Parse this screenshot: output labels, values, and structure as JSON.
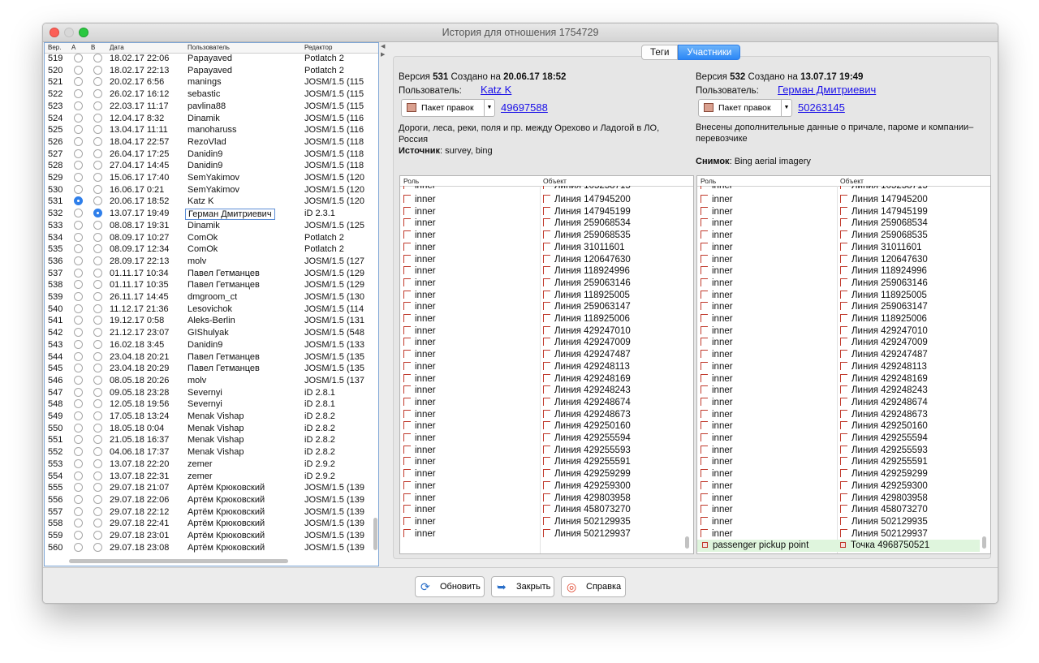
{
  "window": {
    "title": "История для отношения 1754729"
  },
  "left": {
    "headers": [
      "Вер.",
      "A",
      "B",
      "Дата",
      "Пользователь",
      "Редактор"
    ],
    "rows": [
      {
        "ver": "519",
        "date": "18.02.17 22:06",
        "user": "Papayaved",
        "editor": "Potlatch 2"
      },
      {
        "ver": "520",
        "date": "18.02.17 22:13",
        "user": "Papayaved",
        "editor": "Potlatch 2"
      },
      {
        "ver": "521",
        "date": "20.02.17 6:56",
        "user": "manings",
        "editor": "JOSM/1.5 (115"
      },
      {
        "ver": "522",
        "date": "26.02.17 16:12",
        "user": "sebastic",
        "editor": "JOSM/1.5 (115"
      },
      {
        "ver": "523",
        "date": "22.03.17 11:17",
        "user": "pavlina88",
        "editor": "JOSM/1.5 (115"
      },
      {
        "ver": "524",
        "date": "12.04.17 8:32",
        "user": "Dinamik",
        "editor": "JOSM/1.5 (116"
      },
      {
        "ver": "525",
        "date": "13.04.17 11:11",
        "user": "manoharuss",
        "editor": "JOSM/1.5 (116"
      },
      {
        "ver": "526",
        "date": "18.04.17 22:57",
        "user": "RezoVlad",
        "editor": "JOSM/1.5 (118"
      },
      {
        "ver": "527",
        "date": "26.04.17 17:25",
        "user": "Danidin9",
        "editor": "JOSM/1.5 (118"
      },
      {
        "ver": "528",
        "date": "27.04.17 14:45",
        "user": "Danidin9",
        "editor": "JOSM/1.5 (118"
      },
      {
        "ver": "529",
        "date": "15.06.17 17:40",
        "user": "SemYakimov",
        "editor": "JOSM/1.5 (120"
      },
      {
        "ver": "530",
        "date": "16.06.17 0:21",
        "user": "SemYakimov",
        "editor": "JOSM/1.5 (120"
      },
      {
        "ver": "531",
        "date": "20.06.17 18:52",
        "user": "Katz K",
        "editor": "JOSM/1.5 (120"
      },
      {
        "ver": "532",
        "date": "13.07.17 19:49",
        "user": "Герман Дмитриевич",
        "editor": "iD 2.3.1"
      },
      {
        "ver": "533",
        "date": "08.08.17 19:31",
        "user": "Dinamik",
        "editor": "JOSM/1.5 (125"
      },
      {
        "ver": "534",
        "date": "08.09.17 10:27",
        "user": "ComOk",
        "editor": "Potlatch 2"
      },
      {
        "ver": "535",
        "date": "08.09.17 12:34",
        "user": "ComOk",
        "editor": "Potlatch 2"
      },
      {
        "ver": "536",
        "date": "28.09.17 22:13",
        "user": "molv",
        "editor": "JOSM/1.5 (127"
      },
      {
        "ver": "537",
        "date": "01.11.17 10:34",
        "user": "Павел Гетманцев",
        "editor": "JOSM/1.5 (129"
      },
      {
        "ver": "538",
        "date": "01.11.17 10:35",
        "user": "Павел Гетманцев",
        "editor": "JOSM/1.5 (129"
      },
      {
        "ver": "539",
        "date": "26.11.17 14:45",
        "user": "dmgroom_ct",
        "editor": "JOSM/1.5 (130"
      },
      {
        "ver": "540",
        "date": "11.12.17 21:36",
        "user": "Lesovichok",
        "editor": "JOSM/1.5 (114"
      },
      {
        "ver": "541",
        "date": "19.12.17 0:58",
        "user": "Aleks-Berlin",
        "editor": "JOSM/1.5 (131"
      },
      {
        "ver": "542",
        "date": "21.12.17 23:07",
        "user": "GIShulyak",
        "editor": "JOSM/1.5 (548"
      },
      {
        "ver": "543",
        "date": "16.02.18 3:45",
        "user": "Danidin9",
        "editor": "JOSM/1.5 (133"
      },
      {
        "ver": "544",
        "date": "23.04.18 20:21",
        "user": "Павел Гетманцев",
        "editor": "JOSM/1.5 (135"
      },
      {
        "ver": "545",
        "date": "23.04.18 20:29",
        "user": "Павел Гетманцев",
        "editor": "JOSM/1.5 (135"
      },
      {
        "ver": "546",
        "date": "08.05.18 20:26",
        "user": "molv",
        "editor": "JOSM/1.5 (137"
      },
      {
        "ver": "547",
        "date": "09.05.18 23:28",
        "user": "Severnyi",
        "editor": "iD 2.8.1"
      },
      {
        "ver": "548",
        "date": "12.05.18 19:56",
        "user": "Severnyi",
        "editor": "iD 2.8.1"
      },
      {
        "ver": "549",
        "date": "17.05.18 13:24",
        "user": "Menak Vishap",
        "editor": "iD 2.8.2"
      },
      {
        "ver": "550",
        "date": "18.05.18 0:04",
        "user": "Menak Vishap",
        "editor": "iD 2.8.2"
      },
      {
        "ver": "551",
        "date": "21.05.18 16:37",
        "user": "Menak Vishap",
        "editor": "iD 2.8.2"
      },
      {
        "ver": "552",
        "date": "04.06.18 17:37",
        "user": "Menak Vishap",
        "editor": "iD 2.8.2"
      },
      {
        "ver": "553",
        "date": "13.07.18 22:20",
        "user": "zemer",
        "editor": "iD 2.9.2"
      },
      {
        "ver": "554",
        "date": "13.07.18 22:31",
        "user": "zemer",
        "editor": "iD 2.9.2"
      },
      {
        "ver": "555",
        "date": "29.07.18 21:07",
        "user": "Артём Крюковский",
        "editor": "JOSM/1.5 (139"
      },
      {
        "ver": "556",
        "date": "29.07.18 22:06",
        "user": "Артём Крюковский",
        "editor": "JOSM/1.5 (139"
      },
      {
        "ver": "557",
        "date": "29.07.18 22:12",
        "user": "Артём Крюковский",
        "editor": "JOSM/1.5 (139"
      },
      {
        "ver": "558",
        "date": "29.07.18 22:41",
        "user": "Артём Крюковский",
        "editor": "JOSM/1.5 (139"
      },
      {
        "ver": "559",
        "date": "29.07.18 23:01",
        "user": "Артём Крюковский",
        "editor": "JOSM/1.5 (139"
      },
      {
        "ver": "560",
        "date": "29.07.18 23:08",
        "user": "Артём Крюковский",
        "editor": "JOSM/1.5 (139"
      }
    ],
    "selected_a": "531",
    "selected_b": "532"
  },
  "tabs": [
    "Теги",
    "Участники"
  ],
  "active_tab": "Участники",
  "versions": [
    {
      "version_prefix": "Версия",
      "version": "531",
      "created_label": "Создано на",
      "created": "20.06.17 18:52",
      "user_label": "Пользователь:",
      "user": "Katz K",
      "changeset_button": "Пакет правок",
      "changeset": "49697588",
      "comment": "Дороги, леса, реки, поля и пр. между Орехово и Ладогой в ЛО, Россия",
      "source_label": "Источник",
      "source": "survey, bing"
    },
    {
      "version_prefix": "Версия",
      "version": "532",
      "created_label": "Создано на",
      "created": "13.07.17 19:49",
      "user_label": "Пользователь:",
      "user": "Герман Дмитриевич",
      "changeset_button": "Пакет правок",
      "changeset": "50263145",
      "comment": "Внесены дополнительные данные о причале, пароме и компании–перевозчике",
      "imagery_label": "Снимок",
      "imagery": "Bing aerial imagery"
    }
  ],
  "members": {
    "headers": [
      "Роль",
      "Объект"
    ],
    "partial_top": {
      "role": "inner",
      "object": "Линия 105258715"
    },
    "rows": [
      {
        "role": "inner",
        "object": "Линия 147945200"
      },
      {
        "role": "inner",
        "object": "Линия 147945199"
      },
      {
        "role": "inner",
        "object": "Линия 259068534"
      },
      {
        "role": "inner",
        "object": "Линия 259068535"
      },
      {
        "role": "inner",
        "object": "Линия 31011601"
      },
      {
        "role": "inner",
        "object": "Линия 120647630"
      },
      {
        "role": "inner",
        "object": "Линия 118924996"
      },
      {
        "role": "inner",
        "object": "Линия 259063146"
      },
      {
        "role": "inner",
        "object": "Линия 118925005"
      },
      {
        "role": "inner",
        "object": "Линия 259063147"
      },
      {
        "role": "inner",
        "object": "Линия 118925006"
      },
      {
        "role": "inner",
        "object": "Линия 429247010"
      },
      {
        "role": "inner",
        "object": "Линия 429247009"
      },
      {
        "role": "inner",
        "object": "Линия 429247487"
      },
      {
        "role": "inner",
        "object": "Линия 429248113"
      },
      {
        "role": "inner",
        "object": "Линия 429248169"
      },
      {
        "role": "inner",
        "object": "Линия 429248243"
      },
      {
        "role": "inner",
        "object": "Линия 429248674"
      },
      {
        "role": "inner",
        "object": "Линия 429248673"
      },
      {
        "role": "inner",
        "object": "Линия 429250160"
      },
      {
        "role": "inner",
        "object": "Линия 429255594"
      },
      {
        "role": "inner",
        "object": "Линия 429255593"
      },
      {
        "role": "inner",
        "object": "Линия 429255591"
      },
      {
        "role": "inner",
        "object": "Линия 429259299"
      },
      {
        "role": "inner",
        "object": "Линия 429259300"
      },
      {
        "role": "inner",
        "object": "Линия 429803958"
      },
      {
        "role": "inner",
        "object": "Линия 458073270"
      },
      {
        "role": "inner",
        "object": "Линия 502129935"
      },
      {
        "role": "inner",
        "object": "Линия 502129937"
      }
    ],
    "added_right": {
      "role": "passenger pickup point",
      "object": "Точка 4968750521"
    }
  },
  "buttons": {
    "refresh": "Обновить",
    "close": "Закрыть",
    "help": "Справка"
  },
  "colors": {
    "link": "#1a10e8",
    "accent": "#2b87f6",
    "added_row": "#dff5dd"
  }
}
